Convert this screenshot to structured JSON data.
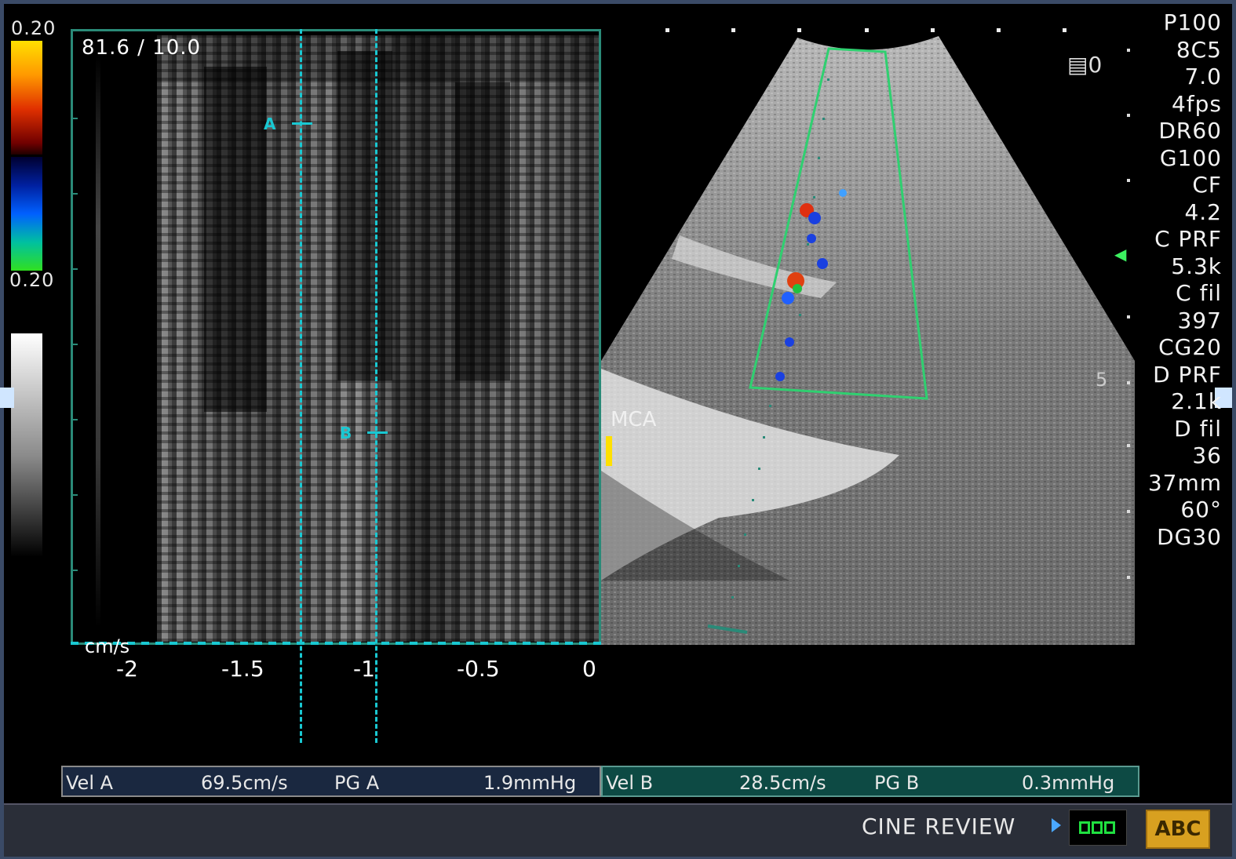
{
  "color_scale": {
    "top_value": "0.20",
    "bottom_value": "0.20"
  },
  "spectrum": {
    "header": "81.6 / 10.0",
    "unit": "cm/s",
    "x_ticks": [
      "-2",
      "-1.5",
      "-1",
      "-0.5",
      "0"
    ],
    "cursor_a_label": "A",
    "cursor_b_label": "B"
  },
  "sector": {
    "vessel_label": "MCA",
    "depth_marker": "5"
  },
  "params": {
    "p": "P100",
    "probe": "8C5",
    "freq": "7.0",
    "fps": "4fps",
    "dr": "DR60",
    "gain": "G100",
    "cf": "CF",
    "cf_val": "4.2",
    "cprf": "C PRF",
    "cprf_val": "5.3k",
    "cfil": "C fil",
    "cfil_val": "397",
    "cg": "CG20",
    "dprf": "D PRF",
    "dprf_val": "2.1k",
    "dfil": "D fil",
    "dfil_val": "36",
    "depth": "37mm",
    "angle": "60°",
    "dg": "DG30",
    "icon_count": "0"
  },
  "measurements": {
    "vel_a_label": "Vel A",
    "vel_a_value": "69.5cm/s",
    "pg_a_label": "PG A",
    "pg_a_value": "1.9mmHg",
    "vel_b_label": "Vel B",
    "vel_b_value": "28.5cm/s",
    "pg_b_label": "PG B",
    "pg_b_value": "0.3mmHg"
  },
  "bottom_bar": {
    "cine_label": "CINE REVIEW",
    "abc_label": "ABC"
  },
  "colors": {
    "accent_cyan": "#19c8d2",
    "frame_green": "#2a8a78",
    "abc_yellow": "#d8a020"
  }
}
